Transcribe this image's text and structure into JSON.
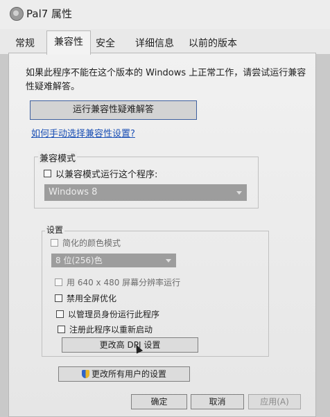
{
  "window": {
    "title": "Pal7 属性"
  },
  "tabs": [
    "常规",
    "兼容性",
    "安全",
    "详细信息",
    "以前的版本"
  ],
  "active_tab": "兼容性",
  "description": "如果此程序不能在这个版本的 Windows 上正常工作，请尝试运行兼容性疑难解答。",
  "troubleshoot_button": "运行兼容性疑难解答",
  "manual_link": "如何手动选择兼容性设置?",
  "compat_mode": {
    "label": "兼容模式",
    "checkbox": "以兼容模式运行这个程序:",
    "checked": false,
    "selected_os": "Windows 8"
  },
  "settings": {
    "label": "设置",
    "reduced_color": "简化的颜色模式",
    "color_option": "8 位(256)色",
    "res_640": "用 640 x 480 屏幕分辨率运行",
    "disable_fullscreen_opt": "禁用全屏优化",
    "run_as_admin": "以管理员身份运行此程序",
    "register_restart": "注册此程序以重新启动",
    "dpi_button": "更改高 DPI 设置"
  },
  "all_users_button": "更改所有用户的设置",
  "footer": {
    "ok": "确定",
    "cancel": "取消",
    "apply": "应用(A)"
  },
  "colors": {
    "link": "#1a4fb5",
    "focus_border": "#3e5f9e"
  }
}
